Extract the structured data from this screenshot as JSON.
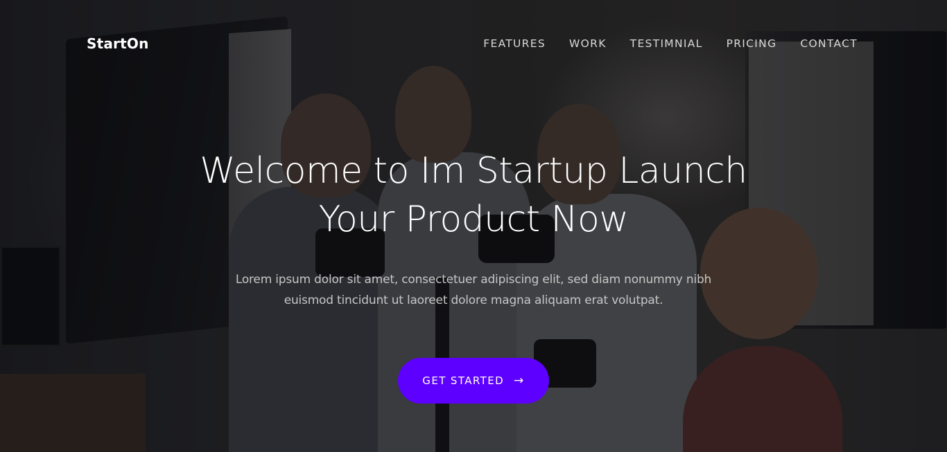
{
  "brand": "StartOn",
  "nav": {
    "items": [
      "FEATURES",
      "WORK",
      "TESTIMNIAL",
      "PRICING",
      "CONTACT"
    ]
  },
  "hero": {
    "title_line1": "Welcome to Im Startup Launch",
    "title_line2": "Your Product Now",
    "subtitle_line1": "Lorem ipsum dolor sit amet, consectetuer adipiscing elit, sed diam nonummy nibh",
    "subtitle_line2": "euismod tincidunt ut laoreet dolore magna aliquam erat volutpat.",
    "cta_label": "GET STARTED",
    "cta_icon": "arrow-right-icon",
    "cta_color": "#5e00ff"
  }
}
